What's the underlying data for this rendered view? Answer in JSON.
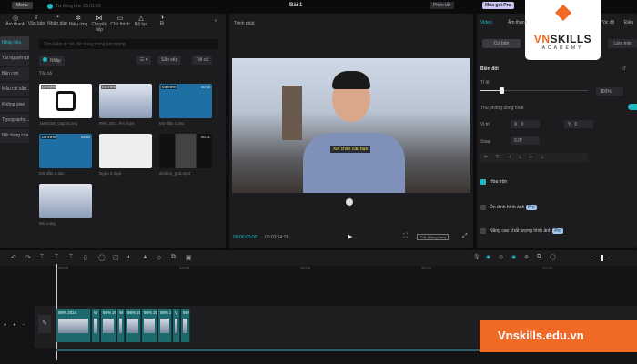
{
  "topbar": {
    "menu": "Menu",
    "autosave": "Tự động lưu: 15:01:59",
    "project_title": "Bài 1",
    "share": "Phím tắt",
    "pro": "Mua gói Pro"
  },
  "toolbar": [
    {
      "icon": "audio-icon",
      "label": "Âm thanh"
    },
    {
      "icon": "text-icon",
      "label": "Văn bản"
    },
    {
      "icon": "sticker-icon",
      "label": "Nhãn dán"
    },
    {
      "icon": "effects-icon",
      "label": "Hiệu ứng"
    },
    {
      "icon": "transition-icon",
      "label": "Chuyển tiếp"
    },
    {
      "icon": "caption-icon",
      "label": "Chú thích"
    },
    {
      "icon": "filter-icon",
      "label": "Bộ lọc"
    },
    {
      "icon": "adjust-icon",
      "label": "Đi"
    }
  ],
  "sidebar": [
    "Nhập liệu",
    "Tài nguyên phương...",
    "Bản con",
    "Mẫu cài sẵn...",
    "Không gian",
    "Typography...",
    "Nội dung của..."
  ],
  "media": {
    "search_placeholder": "Tìm kiếm tư ản, đồ trong trong âm thông",
    "import": "Nhập",
    "sort": "Sắp xếp",
    "all_filter": "Tất cả",
    "section": "Tất cả",
    "items": [
      {
        "tag": "Đã thêm",
        "name": "1566258_capcut.png",
        "duration": ""
      },
      {
        "tag": "Đã thêm",
        "name": "98% 202...Pro.mp4",
        "duration": ""
      },
      {
        "tag": "Đã thêm",
        "name": "Mở đầu 1.aac",
        "duration": "00:03"
      },
      {
        "tag": "Đã thêm",
        "name": "Mở đầu 2.aac",
        "duration": "00:40"
      },
      {
        "tag": "",
        "name": "Ngàn 2.mp4",
        "duration": ""
      },
      {
        "tag": "",
        "name": "divideo_gnd.mp4",
        "duration": "00:21"
      },
      {
        "tag": "",
        "name": "Bài Lang",
        "duration": ""
      }
    ]
  },
  "player": {
    "title": "Trình phát",
    "current": "00:00:00:00",
    "total": "00:03:54:28",
    "ratio": "Tỉ lệ (Rộng hơn)",
    "subtitle": "Xin chào các bạn"
  },
  "inspector": {
    "tabs": [
      "Video",
      "Âm thanh",
      "Tốc độ",
      "Điều"
    ],
    "subtabs": [
      "Cơ bản",
      "Làm mịn"
    ],
    "transform": "Biến đổi",
    "scale_label": "Tỉ lệ",
    "scale_value": "100%",
    "scale_fraction": 1.0,
    "uniform": "Thu phóng đồng nhất",
    "position": "Vị trí",
    "x_label": "X",
    "x_value": "0",
    "y_label": "Y",
    "y_value": "0",
    "rotate": "Xoay",
    "rotate_value": "0.0°",
    "blend": "Hòa trộn",
    "stabilize": "Ổn định hình ảnh",
    "enhance": "Nâng cao chất lượng hình ảnh",
    "pro_badge": "Pro"
  },
  "timeline": {
    "ruler": [
      "00:00",
      "10:00",
      "20:00",
      "30:00",
      "40:00"
    ],
    "clips": [
      "98% 2024",
      "W",
      "98% 2024",
      "W",
      "98% 202",
      "98% 2024",
      "98% 2",
      "V",
      "98%"
    ]
  },
  "brand": {
    "logo_main": "VNSKILLS",
    "logo_sub": "ACADEMY",
    "banner": "Vnskills.edu.vn",
    "accent": "#f06a25",
    "teal": "#1fb8c4"
  }
}
